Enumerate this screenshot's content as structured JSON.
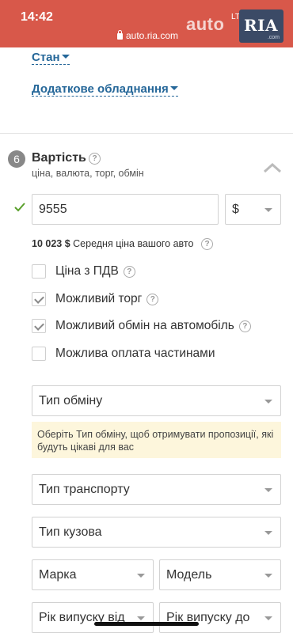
{
  "status_bar": {
    "time": "14:42"
  },
  "browser": {
    "url": "auto.ria.com",
    "brand_text": "auto",
    "signal_text": "LTE"
  },
  "logo": {
    "main": "RIA",
    "sub": ".com"
  },
  "links": {
    "state": "Стан",
    "equipment": "Додаткове обладнання"
  },
  "section": {
    "number": "6",
    "title": "Вартість",
    "subtitle": "ціна, валюта, торг, обмін",
    "help": "?"
  },
  "price": {
    "value": "9555",
    "currency": "$"
  },
  "average": {
    "amount": "10 023 $",
    "label": "Середня ціна вашого авто",
    "help": "?"
  },
  "options": [
    {
      "label": "Ціна з ПДВ",
      "checked": false,
      "help": "?"
    },
    {
      "label": "Можливий торг",
      "checked": true,
      "help": "?"
    },
    {
      "label": "Можливий обмін на автомобіль",
      "checked": true,
      "help": "?"
    },
    {
      "label": "Можлива оплата частинами",
      "checked": false,
      "help": ""
    }
  ],
  "exchange": {
    "type_placeholder": "Тип обміну",
    "hint": "Оберіть Тип обміну, щоб отримувати пропозиції, які будуть цікаві для вас",
    "transport_placeholder": "Тип транспорту",
    "body_placeholder": "Тип кузова",
    "make_placeholder": "Марка",
    "model_placeholder": "Модель",
    "year_from_placeholder": "Рік випуску від",
    "year_to_placeholder": "Рік випуску до"
  },
  "colors": {
    "topbar": "#d8584a",
    "link": "#256799",
    "hint_bg": "#fdf6dc",
    "ok_check": "#5aa02c"
  }
}
